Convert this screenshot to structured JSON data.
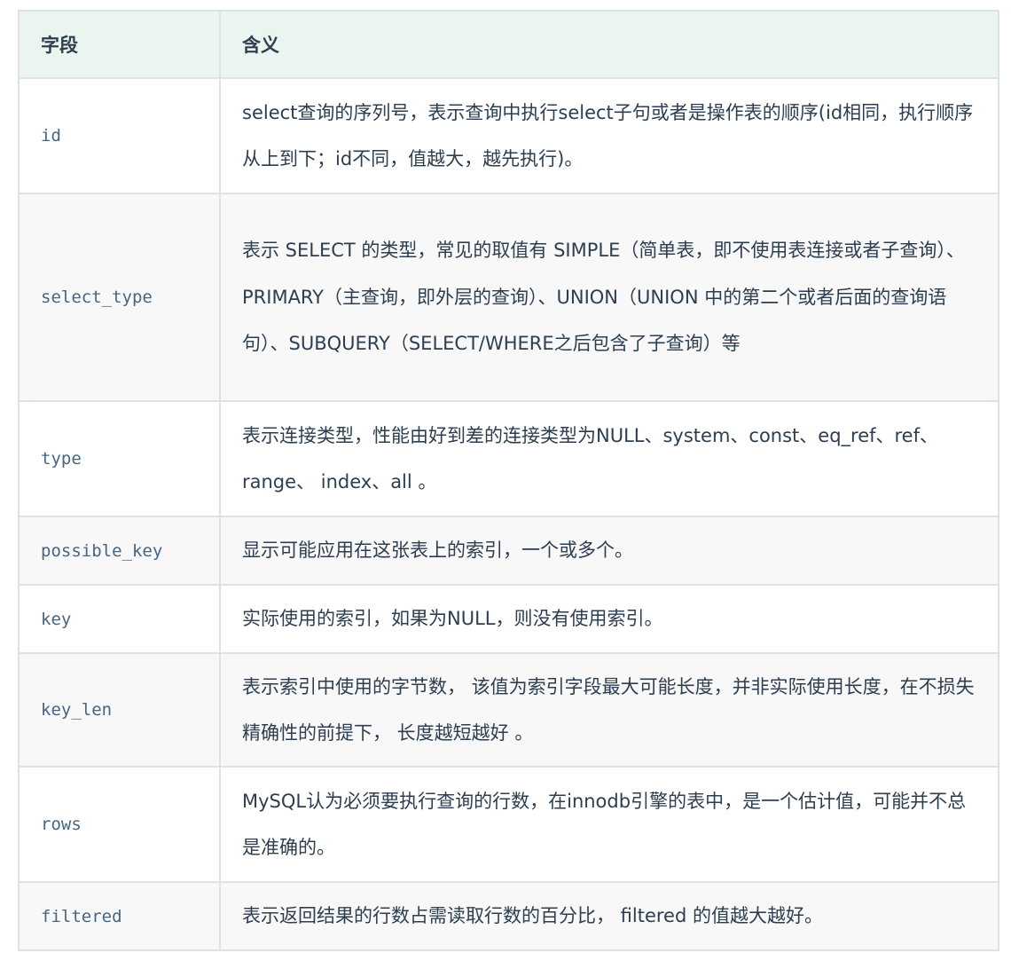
{
  "table": {
    "headers": [
      "字段",
      "含义"
    ],
    "rows": [
      {
        "field": "id",
        "desc": "select查询的序列号，表示查询中执行select子句或者是操作表的顺序(id相同，执行顺序从上到下；id不同，值越大，越先执行)。"
      },
      {
        "field": "select_type",
        "desc": "表示 SELECT 的类型，常见的取值有 SIMPLE（简单表，即不使用表连接或者子查询）、PRIMARY（主查询，即外层的查询）、UNION（UNION 中的第二个或者后面的查询语句）、SUBQUERY（SELECT/WHERE之后包含了子查询）等"
      },
      {
        "field": "type",
        "desc": "表示连接类型，性能由好到差的连接类型为NULL、system、const、eq_ref、ref、range、 index、all 。"
      },
      {
        "field": "possible_key",
        "desc": "显示可能应用在这张表上的索引，一个或多个。"
      },
      {
        "field": "key",
        "desc": "实际使用的索引，如果为NULL，则没有使用索引。"
      },
      {
        "field": "key_len",
        "desc": "表示索引中使用的字节数， 该值为索引字段最大可能长度，并非实际使用长度，在不损失精确性的前提下， 长度越短越好 。"
      },
      {
        "field": "rows",
        "desc": "MySQL认为必须要执行查询的行数，在innodb引擎的表中，是一个估计值，可能并不总是准确的。"
      },
      {
        "field": "filtered",
        "desc": "表示返回结果的行数占需读取行数的百分比， filtered 的值越大越好。"
      }
    ]
  }
}
